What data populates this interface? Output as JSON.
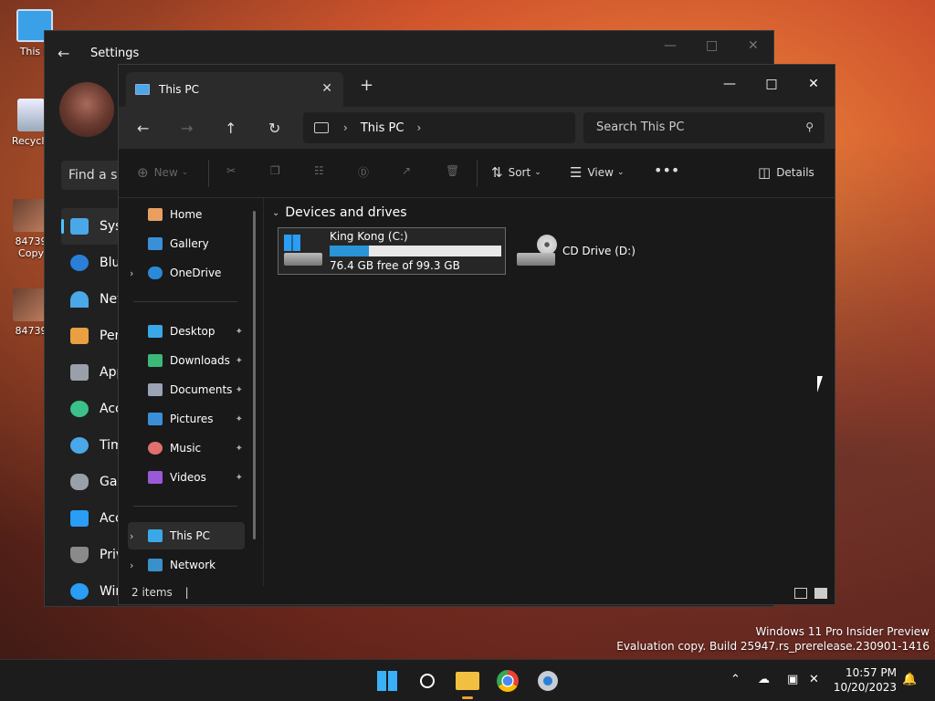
{
  "desktop": {
    "icons": [
      {
        "label": "This P"
      },
      {
        "label": "Recycle"
      },
      {
        "label": "84739"
      },
      {
        "label": "Copy"
      },
      {
        "label": "84739"
      }
    ],
    "watermark": {
      "line1": "Windows 11 Pro Insider Preview",
      "line2": "Evaluation copy. Build 25947.rs_prerelease.230901-1416"
    }
  },
  "settings": {
    "title": "Settings",
    "search_placeholder": "Find a se",
    "nav": [
      {
        "label": "Syst",
        "icon": "monitor-icon",
        "color": "#4aa8e8"
      },
      {
        "label": "Blue",
        "icon": "bluetooth-icon",
        "color": "#2a7fd6"
      },
      {
        "label": "Net",
        "icon": "wifi-icon",
        "color": "#4aa8e8"
      },
      {
        "label": "Pers",
        "icon": "brush-icon",
        "color": "#e8a040"
      },
      {
        "label": "App",
        "icon": "apps-icon",
        "color": "#9aa0aa"
      },
      {
        "label": "Acc",
        "icon": "person-icon",
        "color": "#3cc08a"
      },
      {
        "label": "Tim",
        "icon": "clock-icon",
        "color": "#4aa8e8"
      },
      {
        "label": "Gar",
        "icon": "gamepad-icon",
        "color": "#9aa0aa"
      },
      {
        "label": "Acc",
        "icon": "accessibility-icon",
        "color": "#2a9df4"
      },
      {
        "label": "Priv",
        "icon": "shield-icon",
        "color": "#8a8a8a"
      },
      {
        "label": "Win",
        "icon": "update-icon",
        "color": "#2a9df4"
      }
    ]
  },
  "explorer": {
    "tab_title": "This PC",
    "address": {
      "location": "This PC"
    },
    "search_placeholder": "Search This PC",
    "commands": {
      "new": "New",
      "sort": "Sort",
      "view": "View",
      "details": "Details"
    },
    "nav": {
      "home": "Home",
      "gallery": "Gallery",
      "onedrive": "OneDrive",
      "desktop": "Desktop",
      "downloads": "Downloads",
      "documents": "Documents",
      "pictures": "Pictures",
      "music": "Music",
      "videos": "Videos",
      "thispc": "This PC",
      "network": "Network"
    },
    "group_title": "Devices and drives",
    "drives": [
      {
        "name": "King Kong (C:)",
        "free_text": "76.4 GB free of 99.3 GB",
        "used_fraction": 0.23
      },
      {
        "name": "CD Drive (D:)"
      }
    ],
    "status": "2 items"
  },
  "taskbar": {
    "clock_time": "10:57 PM",
    "clock_date": "10/20/2023"
  },
  "colors": {
    "accent": "#4cc2ff",
    "drive_bar": "#2a95d6"
  }
}
